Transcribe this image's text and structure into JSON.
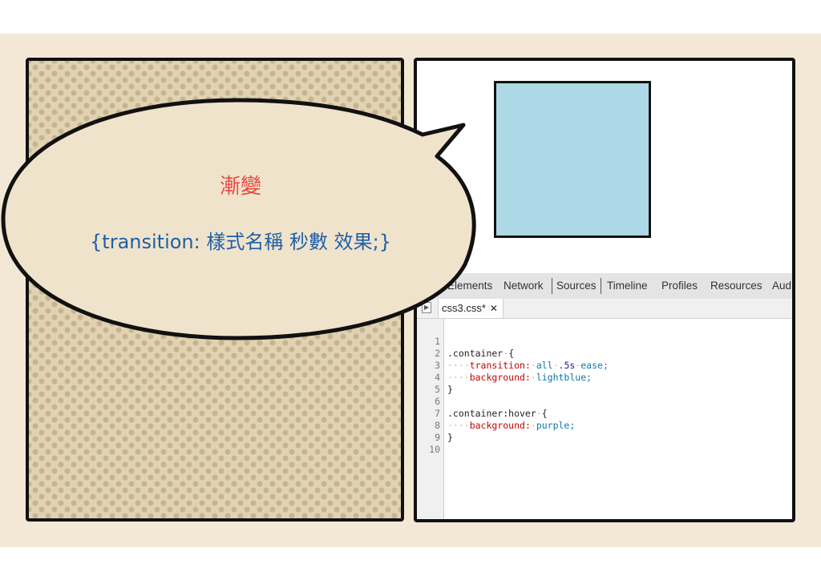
{
  "bubble": {
    "title": "漸變",
    "syntax": "{transition: 樣式名稱 秒數 效果;}"
  },
  "devtools": {
    "tabs": [
      "Elements",
      "Network",
      "Sources",
      "Timeline",
      "Profiles",
      "Resources",
      "Aud"
    ],
    "active_tab": "Sources",
    "file_tab": "css3.css*",
    "file_close": "✕",
    "line_numbers": [
      "1",
      "2",
      "3",
      "4",
      "5",
      "6",
      "7",
      "8",
      "9",
      "10"
    ],
    "code": {
      "l1_selector": ".container",
      "l1_brace": "{",
      "l2_prop": "transition:",
      "l2_v1": "all",
      "l2_v2": ".5s",
      "l2_v3": "ease;",
      "l3_prop": "background:",
      "l3_val": "lightblue;",
      "l4": "}",
      "l6_selector": ".container:hover",
      "l6_brace": "{",
      "l7_prop": "background:",
      "l7_val": "purple;",
      "l8": "}"
    }
  },
  "colors": {
    "demo_box": "#add8e6",
    "title_text": "#e8433a",
    "syntax_text": "#1e5fa8",
    "background": "#f3e8d6"
  }
}
